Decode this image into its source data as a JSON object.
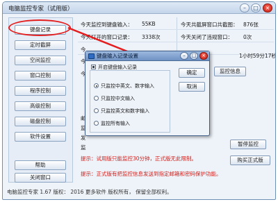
{
  "window": {
    "title": "电脑监控专家（试用版）",
    "controls": {
      "minimize": "–",
      "maximize": "□",
      "close": "×"
    }
  },
  "sidebar": {
    "items": [
      {
        "label": "键盘记录"
      },
      {
        "label": "定时截屏"
      },
      {
        "label": "空间监控"
      },
      {
        "label": "窗口控制"
      },
      {
        "label": "程序控制"
      },
      {
        "label": "高级控制"
      },
      {
        "label": "磁盘控制"
      },
      {
        "label": "软件设置"
      }
    ],
    "help_label": "帮助",
    "close_window_label": "关闭窗口"
  },
  "stats": {
    "kb_input_label": "今天监控到键盘输入：",
    "kb_input_value": "55KB",
    "screenshots_label": "今天共截屏窗口共截图：",
    "screenshots_value": "876张",
    "opened_windows_label": "今天打开的窗口记录：",
    "opened_windows_value": "3338次",
    "closed_label": "今天关闭了违规窗口：",
    "closed_value": "0次",
    "partial_label_1": "今",
    "partial_label_2": "今",
    "partial_label_3": "今",
    "time_value": "1小时59分17秒",
    "monitor_info_label": "监控信息",
    "side_label_1": "邮",
    "side_label_2": "监",
    "side_label_3": "发",
    "side_label_4": "监"
  },
  "buttons": {
    "pause": "暂停监控",
    "buy": "购买正式版"
  },
  "tips": {
    "tip1": "提示：试用版只能监控30分钟，正式版无此限制。",
    "tip2": "提示：正式版有把监控信息发送到指定邮箱和密码保护功能。"
  },
  "status_bar": {
    "text": "电脑监控专家  1.67  版权：  2016  更多软件  版权所有，  保留全部权利。"
  },
  "dialog": {
    "title": "键盘输入记录设置",
    "enable_label": "开启键盘输入记录",
    "enable_checked": true,
    "options": [
      {
        "label": "只监控中英文、数字输入",
        "selected": true
      },
      {
        "label": "只监控中文输入",
        "selected": false
      },
      {
        "label": "只监控英文和数字输入",
        "selected": false
      },
      {
        "label": "监控所有输入",
        "selected": false
      }
    ],
    "ok_label": "确定",
    "cancel_label": "取消"
  },
  "colors": {
    "annotation_red": "#e41e1e",
    "tip_red": "#d0201c",
    "dialog_title": "#7f9fcf"
  }
}
